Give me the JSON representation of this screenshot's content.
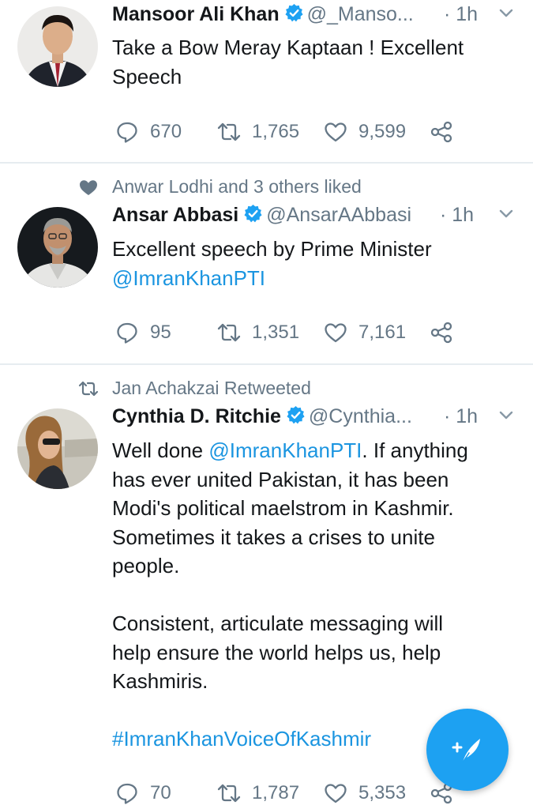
{
  "tweets": [
    {
      "social_context": "",
      "name": "Mansoor Ali Khan",
      "handle": "@_Manso...",
      "time": "· 1h",
      "text_parts": [
        "Take a Bow Meray Kaptaan ! Excellent\nSpeech"
      ],
      "replies": "670",
      "retweets": "1,765",
      "likes": "9,599"
    },
    {
      "social_context": "Anwar Lodhi and 3 others liked",
      "name": "Ansar Abbasi",
      "handle": "@AnsarAAbbasi",
      "time": "· 1h",
      "text_parts": [
        "Excellent speech by Prime Minister\n",
        "@ImranKhanPTI"
      ],
      "replies": "95",
      "retweets": "1,351",
      "likes": "7,161"
    },
    {
      "social_context": "Jan Achakzai Retweeted",
      "name": "Cynthia D. Ritchie",
      "handle": "@Cynthia...",
      "time": "· 1h",
      "text_parts": [
        "Well done ",
        "@ImranKhanPTI",
        ". If anything\nhas ever united Pakistan, it has been\nModi's political maelstrom in Kashmir.\nSometimes it takes a crises to unite\npeople.\n\nConsistent, articulate messaging will\nhelp ensure the world helps us, help\nKashmiris.\n\n",
        "#ImranKhanVoiceOfKashmir"
      ],
      "replies": "70",
      "retweets": "1,787",
      "likes": "5,353"
    }
  ],
  "icons": {
    "verified": "verified-badge-icon",
    "reply": "reply-icon",
    "retweet": "retweet-icon",
    "like": "heart-icon",
    "share": "share-icon",
    "more": "chevron-down-icon",
    "compose": "compose-tweet-icon"
  },
  "colors": {
    "link": "#1b95e0",
    "accent": "#1da1f2",
    "secondary_text": "#657786",
    "divider": "#e6ecf0"
  }
}
